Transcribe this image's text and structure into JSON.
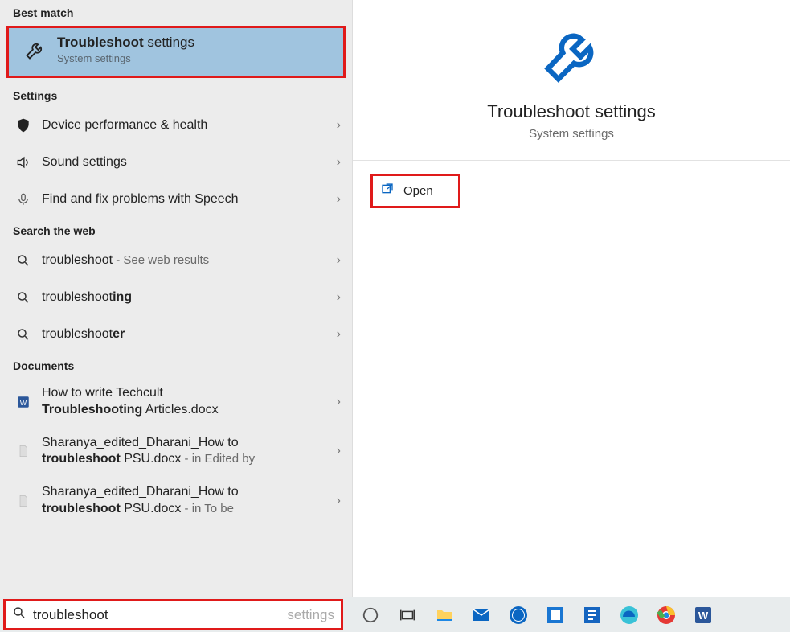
{
  "sections": {
    "best_match": "Best match",
    "settings": "Settings",
    "search_web": "Search the web",
    "documents": "Documents"
  },
  "best_match": {
    "title_prefix": "Troubleshoot",
    "title_rest": " settings",
    "subtitle": "System settings"
  },
  "settings_items": [
    {
      "label": "Device performance & health"
    },
    {
      "label": "Sound settings"
    },
    {
      "label": "Find and fix problems with Speech"
    }
  ],
  "web_items": [
    {
      "prefix": "troubleshoot",
      "rest": "",
      "tail": " - See web results"
    },
    {
      "prefix": "troubleshoot",
      "rest": "ing",
      "tail": ""
    },
    {
      "prefix": "troubleshoot",
      "rest": "er",
      "tail": ""
    }
  ],
  "doc_items": [
    {
      "line1": "How to write Techcult",
      "line2_prefix": "Troubleshooting",
      "line2_rest": " Articles.docx",
      "tail": ""
    },
    {
      "line1": "Sharanya_edited_Dharani_How to",
      "line2_prefix": "troubleshoot",
      "line2_rest": " PSU.docx",
      "tail": " - in Edited by"
    },
    {
      "line1": "Sharanya_edited_Dharani_How to",
      "line2_prefix": "troubleshoot",
      "line2_rest": " PSU.docx",
      "tail": " - in To be"
    }
  ],
  "detail": {
    "title": "Troubleshoot settings",
    "subtitle": "System settings",
    "open": "Open"
  },
  "search": {
    "value": "troubleshoot",
    "placeholder": "settings"
  },
  "colors": {
    "accent": "#0a66c2",
    "highlight_bg": "#a0c4df",
    "annotation_red": "#e01a1a"
  }
}
